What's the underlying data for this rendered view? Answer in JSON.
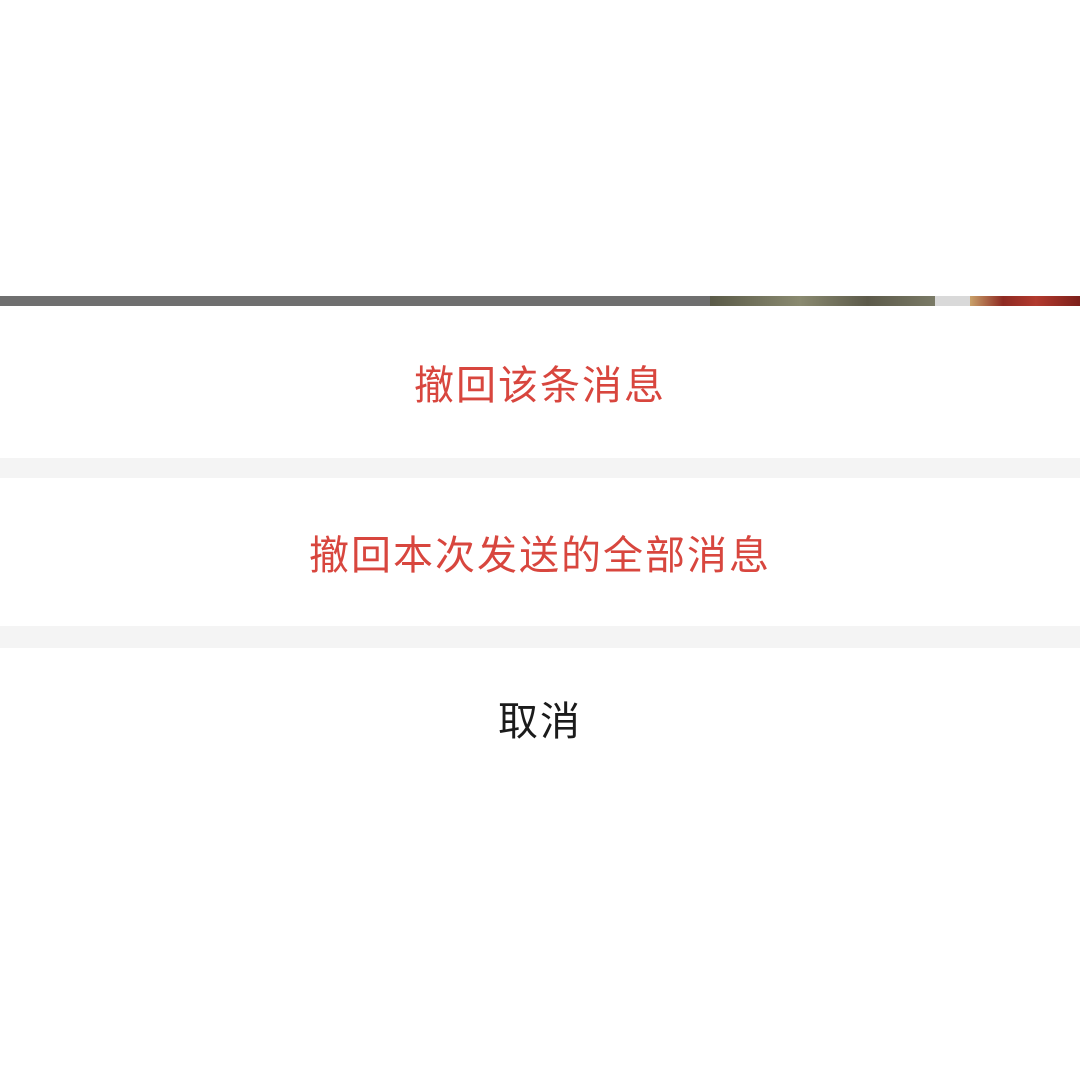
{
  "action_sheet": {
    "items": [
      {
        "label": "撤回该条消息",
        "style": "destructive",
        "color": "#d8463e"
      },
      {
        "label": "撤回本次发送的全部消息",
        "style": "destructive",
        "color": "#d8463e"
      },
      {
        "label": "取消",
        "style": "cancel",
        "color": "#1b1b1b"
      }
    ]
  },
  "colors": {
    "sheet_background": "#ffffff",
    "separator": "#f4f4f4",
    "backdrop_strip": "#6f6f6f"
  }
}
